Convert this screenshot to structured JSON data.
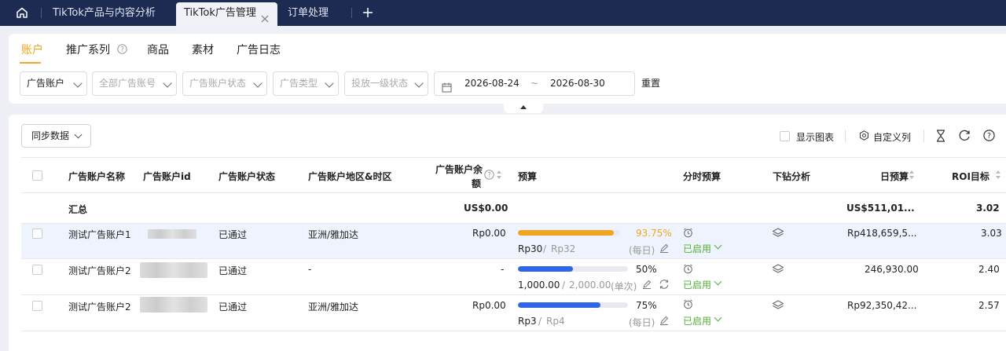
{
  "tabs": [
    "TikTok产品与内容分析",
    "TikTok广告管理",
    "订单处理"
  ],
  "subtabs": [
    "账户",
    "推广系列",
    "商品",
    "素材",
    "广告日志"
  ],
  "filters": {
    "account": "广告账户",
    "all_accounts": "全部广告账号",
    "account_status": "广告账户状态",
    "ad_type": "广告类型",
    "delivery_status": "投放一级状态",
    "date_start": "2026-08-24",
    "date_sep": "~",
    "date_end": "2026-08-30",
    "reset": "重置"
  },
  "toolbar": {
    "sync": "同步数据",
    "show_chart": "显示图表",
    "custom_columns": "自定义列"
  },
  "columns": {
    "name": "广告账户名称",
    "id": "广告账户id",
    "status": "广告账户状态",
    "region": "广告账户地区&时区",
    "balance_1": "广告账户余",
    "balance_2": "额",
    "budget": "预算",
    "hourly_budget": "分时预算",
    "drilldown": "下钻分析",
    "daily_budget": "日预算",
    "roi_target": "ROI目标"
  },
  "summary": {
    "label": "汇总",
    "balance": "US$0.00",
    "daily_budget": "US$511,01...",
    "roi": "3.02"
  },
  "rows": [
    {
      "name": "测试广告账户1",
      "status": "已通过",
      "region": "亚洲/雅加达",
      "balance": "Rp0.00",
      "pct": "93.75%",
      "pct_value": 0.9375,
      "spent": "Rp30",
      "slash": "/",
      "total": "Rp32",
      "period": "(每日)",
      "enabled": "已启用",
      "daily_budget": "Rp418,659,5...",
      "roi": "3.03"
    },
    {
      "name": "测试广告账户2",
      "status": "已通过",
      "region": "-",
      "balance": "-",
      "pct": "50%",
      "pct_value": 0.5,
      "spent": "1,000.00",
      "slash": "/",
      "total": "2,000.00",
      "period": "(单次)",
      "enabled": "已启用",
      "daily_budget": "246,930.00",
      "roi": "2.40"
    },
    {
      "name": "测试广告账户2",
      "status": "已通过",
      "region": "亚洲/雅加达",
      "balance": "Rp0.00",
      "pct": "75%",
      "pct_value": 0.75,
      "spent": "Rp3",
      "slash": "/",
      "total": "Rp4",
      "period": "(每日)",
      "enabled": "已启用",
      "daily_budget": "Rp92,350,42...",
      "roi": "2.57"
    }
  ],
  "colors": {
    "accent": "#f2a51e",
    "blue": "#2f66e8",
    "green": "#52b035",
    "nav": "#1d2b52"
  }
}
